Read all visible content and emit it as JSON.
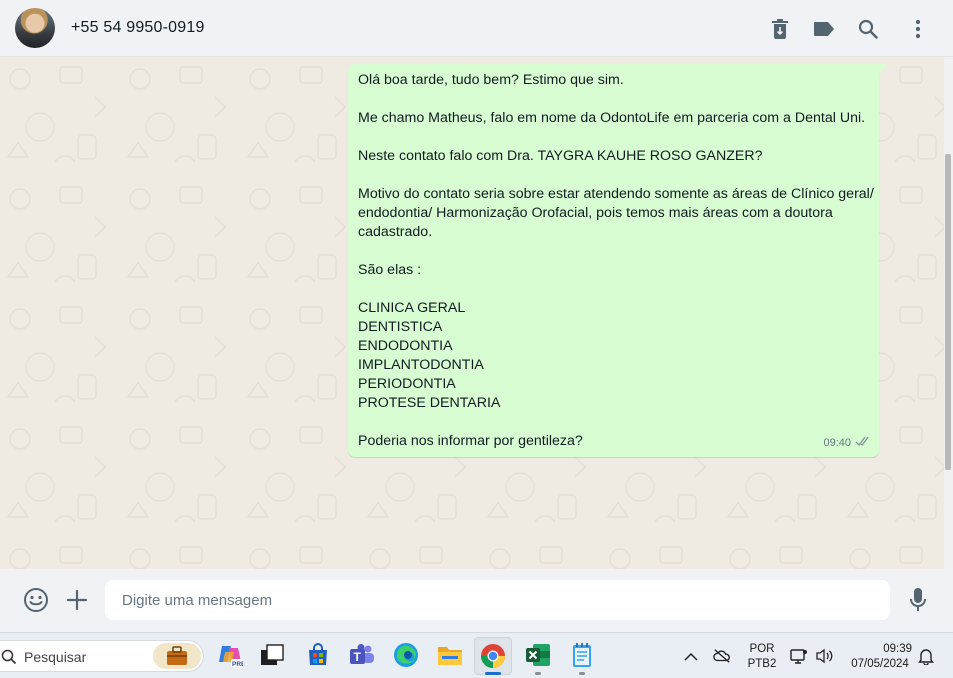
{
  "header": {
    "contact_name": "+55 54 9950-0919",
    "icons": [
      "delete-chat-icon",
      "label-icon",
      "search-icon",
      "menu-dots-icon"
    ]
  },
  "message": {
    "lines": [
      "Olá boa tarde, tudo bem? Estimo que sim.",
      "",
      "Me chamo Matheus, falo em nome da OdontoLife em parceria com a Dental Uni.",
      "",
      "Neste contato falo com Dra. TAYGRA KAUHE ROSO GANZER?",
      "",
      "Motivo do contato seria sobre estar atendendo somente as áreas de Clínico geral/",
      "endodontia/ Harmonização Orofacial, pois temos mais áreas com a doutora",
      "cadastrado.",
      "",
      "São elas :",
      "",
      "CLINICA GERAL",
      "DENTISTICA",
      "ENDODONTIA",
      "IMPLANTODONTIA",
      "PERIODONTIA",
      "PROTESE DENTARIA",
      "",
      "Poderia nos informar por gentileza?"
    ],
    "time": "09:40",
    "status_icon": "double-check-icon"
  },
  "compose": {
    "placeholder": "Digite uma mensagem",
    "icons": [
      "emoji-icon",
      "attach-plus-icon",
      "microphone-icon"
    ]
  },
  "taskbar": {
    "search_label": "Pesquisar",
    "apps": [
      "work-bag-icon",
      "copilot-icon",
      "task-view-icon",
      "store-icon",
      "teams-icon",
      "edge-icon",
      "file-explorer-icon",
      "chrome-icon",
      "excel-icon",
      "notepad-icon"
    ],
    "language_line1": "POR",
    "language_line2": "PTB2",
    "clock_time": "09:39",
    "clock_date": "07/05/2024",
    "colors": {
      "accent": "#1a6fd1",
      "bubble": "#d9fdd3"
    }
  }
}
